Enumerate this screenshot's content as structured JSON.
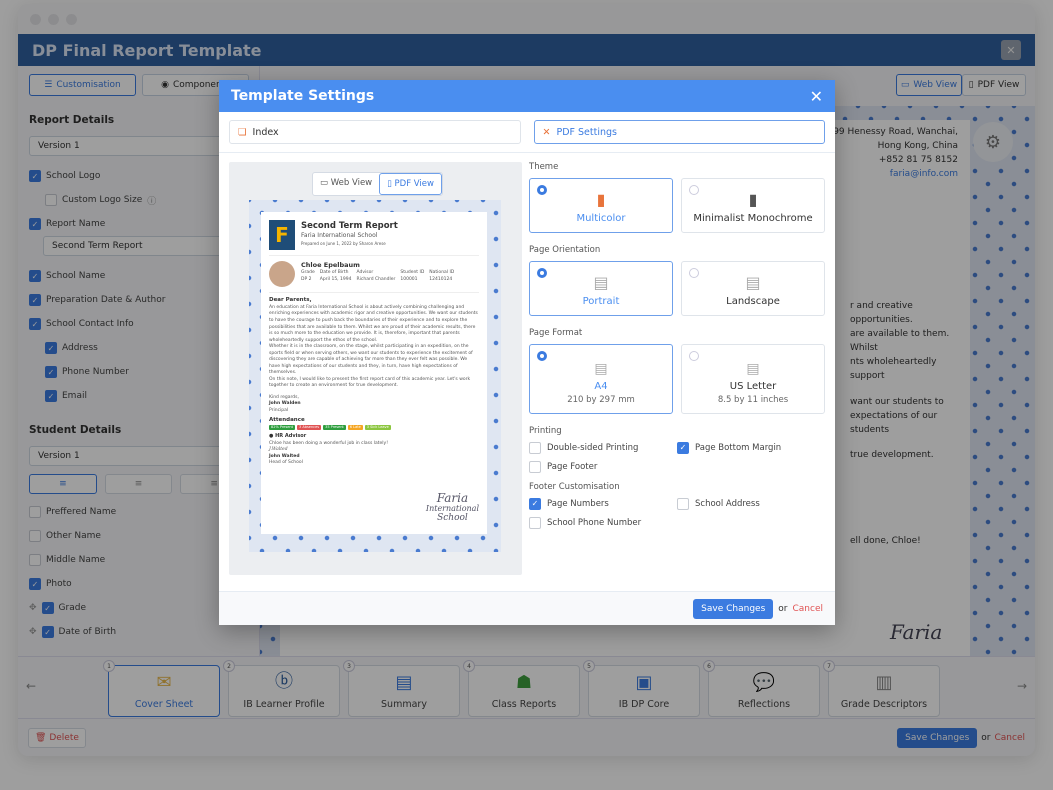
{
  "window": {
    "title": "DP Final Report Template",
    "close_icon": "close-icon"
  },
  "toolbar": {
    "customisation_label": "Customisation",
    "components_label": "Components",
    "web_view_label": "Web View",
    "pdf_view_label": "PDF View"
  },
  "sidebar": {
    "report_details": {
      "title": "Report Details",
      "version": "Version 1",
      "items": [
        {
          "label": "School Logo",
          "checked": true,
          "indent": false
        },
        {
          "label": "Custom Logo Size",
          "checked": false,
          "indent": true,
          "info": true
        },
        {
          "label": "Report Name",
          "checked": true,
          "indent": false
        }
      ],
      "report_name_value": "Second Term Report",
      "items2": [
        {
          "label": "School Name",
          "checked": true
        },
        {
          "label": "Preparation Date & Author",
          "checked": true
        },
        {
          "label": "School Contact Info",
          "checked": true
        },
        {
          "label": "Address",
          "checked": true
        },
        {
          "label": "Phone Number",
          "checked": true
        },
        {
          "label": "Email",
          "checked": true
        }
      ]
    },
    "student_details": {
      "title": "Student Details",
      "version": "Version 1",
      "items": [
        {
          "label": "Preffered Name",
          "checked": false
        },
        {
          "label": "Other Name",
          "checked": false
        },
        {
          "label": "Middle Name",
          "checked": false
        },
        {
          "label": "Photo",
          "checked": true
        },
        {
          "label": "Grade",
          "checked": true
        },
        {
          "label": "Date of Birth",
          "checked": true
        }
      ]
    }
  },
  "background_report": {
    "address": [
      "99 Henessy Road, Wanchai,",
      "Hong Kong, China",
      "+852 81 75 8152"
    ],
    "email": "faria@info.com",
    "text_lines": [
      "r and creative opportunities.",
      "are available to them. Whilst",
      "nts wholeheartedly support",
      "want our students to",
      "expectations of our students",
      "true development.",
      "ell done, Chloe!"
    ],
    "signature": "Faria"
  },
  "bottom_tabs": [
    {
      "num": "1",
      "label": "Cover Sheet",
      "active": true
    },
    {
      "num": "2",
      "label": "IB Learner Profile",
      "active": false
    },
    {
      "num": "3",
      "label": "Summary",
      "active": false
    },
    {
      "num": "4",
      "label": "Class Reports",
      "active": false
    },
    {
      "num": "5",
      "label": "IB DP Core",
      "active": false
    },
    {
      "num": "6",
      "label": "Reflections",
      "active": false
    },
    {
      "num": "7",
      "label": "Grade Descriptors",
      "active": false
    }
  ],
  "footer": {
    "delete_label": "Delete",
    "save_label": "Save Changes",
    "or": "or",
    "cancel_label": "Cancel"
  },
  "modal": {
    "title": "Template Settings",
    "tabs": [
      {
        "label": "Index",
        "active": false
      },
      {
        "label": "PDF Settings",
        "active": true
      }
    ],
    "preview": {
      "web_view": "Web View",
      "pdf_view": "PDF View",
      "report_title": "Second Term Report",
      "school": "Faria International School",
      "prepared": "Prepared on June 1, 2022 by Sharon Arese",
      "student_name": "Chloe Epelbaum",
      "student_fields": [
        {
          "k": "Grade",
          "v": "DP 2"
        },
        {
          "k": "Date of Birth",
          "v": "April 15, 1994"
        },
        {
          "k": "Advisor",
          "v": "Richard Chandler"
        },
        {
          "k": "Student ID",
          "v": "100001"
        },
        {
          "k": "National ID",
          "v": "12410124"
        }
      ],
      "greeting": "Dear Parents,",
      "paragraphs": [
        "An education at Faria International School is about actively combining challenging and enriching experiences with academic rigor and creative opportunities. We want our students to have the courage to push back the boundaries of their experience and to explore the possibilities that are available to them. Whilst we are proud of their academic results, there is so much more to the education we provide. It is, therefore, important that parents wholeheartedly support the ethos of the school.",
        "Whether it is in the classroom, on the stage, whilst participating in an expedition, on the sports field or when serving others, we want our students to experience the excitement of discovering they are capable of achieving far more than they ever felt was possible. We have high expectations of our students and they, in turn, have high expectations of themselves.",
        "On this note, I would like to present the first report card of this academic year. Let's work together to create an environment for true development."
      ],
      "closing": "Kind regards,",
      "signer": "John Walden",
      "signer_role": "Principal",
      "attendance_title": "Attendance",
      "attendance": [
        {
          "label": "82% Present",
          "color": "#2e9e3e"
        },
        {
          "label": "3 Absences",
          "color": "#e05353"
        },
        {
          "label": "35 Present",
          "color": "#2e9e3e"
        },
        {
          "label": "6 Late",
          "color": "#f5a623"
        },
        {
          "label": "3 Sick Leave",
          "color": "#8cc63f"
        }
      ],
      "hr_title": "HR Advisor",
      "hr_comment": "Chloe has been doing a wonderful job in class lately!",
      "hr_sign": "J.Walted",
      "hr_name": "John Walted",
      "hr_role": "Head of School",
      "watermark": [
        "Faria",
        "International",
        "School"
      ]
    },
    "settings": {
      "theme_label": "Theme",
      "themes": [
        {
          "label": "Multicolor",
          "selected": true
        },
        {
          "label": "Minimalist Monochrome",
          "selected": false
        }
      ],
      "orientation_label": "Page Orientation",
      "orientations": [
        {
          "label": "Portrait",
          "selected": true
        },
        {
          "label": "Landscape",
          "selected": false
        }
      ],
      "format_label": "Page Format",
      "formats": [
        {
          "label": "A4",
          "sub": "210 by 297 mm",
          "badge": "A4",
          "selected": true
        },
        {
          "label": "US Letter",
          "sub": "8.5 by 11 inches",
          "badge": "US",
          "selected": false
        }
      ],
      "printing_label": "Printing",
      "printing": [
        {
          "label": "Double-sided Printing",
          "checked": false
        },
        {
          "label": "Page Bottom Margin",
          "checked": true
        },
        {
          "label": "Page Footer",
          "checked": false
        }
      ],
      "footer_label": "Footer Customisation",
      "footer_opts": [
        {
          "label": "Page Numbers",
          "checked": true
        },
        {
          "label": "School Address",
          "checked": false
        },
        {
          "label": "School Phone Number",
          "checked": false
        }
      ]
    },
    "save_label": "Save Changes",
    "or": "or",
    "cancel_label": "Cancel"
  },
  "colors": {
    "accent": "#3b7be0",
    "header": "#4a8ef0",
    "appbar": "#2f5f9f",
    "danger": "#e05353"
  }
}
